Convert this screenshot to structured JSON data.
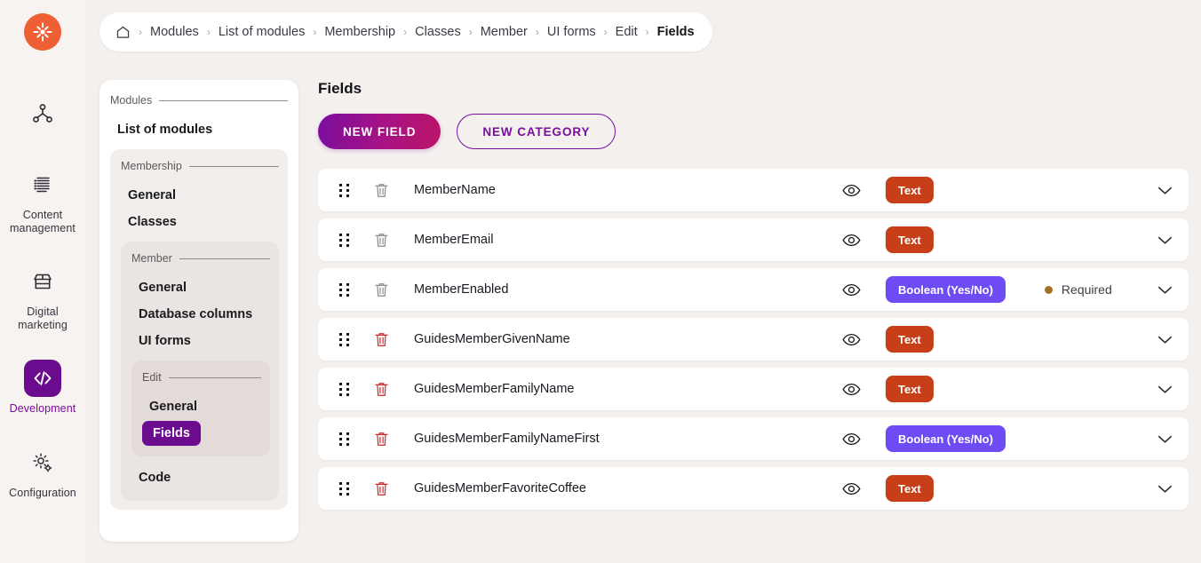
{
  "brand": {
    "logo_icon": "kentico-sunburst-logo",
    "logo_color": "#EE5F34"
  },
  "rail": {
    "items": [
      {
        "label": "Channels",
        "icon": "channels-share-icon",
        "active": false
      },
      {
        "label": "Content\nmanagement",
        "label_line1": "Content",
        "label_line2": "management",
        "icon": "content-management-icon",
        "active": false
      },
      {
        "label": "Digital\nmarketing",
        "label_line1": "Digital",
        "label_line2": "marketing",
        "icon": "digital-marketing-storefront-icon",
        "active": false
      },
      {
        "label": "Development",
        "label_line1": "Development",
        "label_line2": "",
        "icon": "development-code-icon",
        "active": true
      },
      {
        "label": "Configuration",
        "label_line1": "Configuration",
        "label_line2": "",
        "icon": "configuration-gear-icon",
        "active": false
      }
    ]
  },
  "breadcrumb": {
    "home_icon": "home-icon",
    "separator": "›",
    "items": [
      {
        "label": "Modules",
        "current": false
      },
      {
        "label": "List of modules",
        "current": false
      },
      {
        "label": "Membership",
        "current": false
      },
      {
        "label": "Classes",
        "current": false
      },
      {
        "label": "Member",
        "current": false
      },
      {
        "label": "UI forms",
        "current": false
      },
      {
        "label": "Edit",
        "current": false
      },
      {
        "label": "Fields",
        "current": true
      }
    ]
  },
  "navpanel": {
    "group_modules": "Modules",
    "link_list_of_modules": "List of modules",
    "group_membership": "Membership",
    "link_membership_general": "General",
    "link_membership_classes": "Classes",
    "group_member": "Member",
    "link_member_general": "General",
    "link_database_columns": "Database columns",
    "link_ui_forms": "UI forms",
    "group_edit": "Edit",
    "link_edit_general": "General",
    "link_edit_fields": "Fields",
    "link_code": "Code",
    "active_color": "#6B0B8E"
  },
  "main": {
    "title": "Fields",
    "new_field_label": "NEW FIELD",
    "new_category_label": "NEW CATEGORY",
    "primary_color": "#7A0E9E",
    "accent_color": "#BC1469"
  },
  "fields": {
    "type_text": "Text",
    "type_boolean": "Boolean (Yes/No)",
    "required_label": "Required",
    "text_badge_color": "#C63F18",
    "boolean_badge_color": "#6E4BF5",
    "required_dot_color": "#A4712B",
    "rows": [
      {
        "name": "MemberName",
        "type": "Text",
        "type_class": "text",
        "trash_color": "#8E8C91",
        "required": "",
        "has_required": false
      },
      {
        "name": "MemberEmail",
        "type": "Text",
        "type_class": "text",
        "trash_color": "#8E8C91",
        "required": "",
        "has_required": false
      },
      {
        "name": "MemberEnabled",
        "type": "Boolean (Yes/No)",
        "type_class": "bool",
        "trash_color": "#8E8C91",
        "required": "Required",
        "has_required": true
      },
      {
        "name": "GuidesMemberGivenName",
        "type": "Text",
        "type_class": "text",
        "trash_color": "#D8242A",
        "required": "",
        "has_required": false
      },
      {
        "name": "GuidesMemberFamilyName",
        "type": "Text",
        "type_class": "text",
        "trash_color": "#D8242A",
        "required": "",
        "has_required": false
      },
      {
        "name": "GuidesMemberFamilyNameFirst",
        "type": "Boolean (Yes/No)",
        "type_class": "bool",
        "trash_color": "#D8242A",
        "required": "",
        "has_required": false
      },
      {
        "name": "GuidesMemberFavoriteCoffee",
        "type": "Text",
        "type_class": "text",
        "trash_color": "#D8242A",
        "required": "",
        "has_required": false
      }
    ],
    "icons": {
      "drag": "drag-handle-icon",
      "trash": "trash-icon",
      "eye": "eye-visibility-icon",
      "chevron": "chevron-down-icon"
    }
  }
}
